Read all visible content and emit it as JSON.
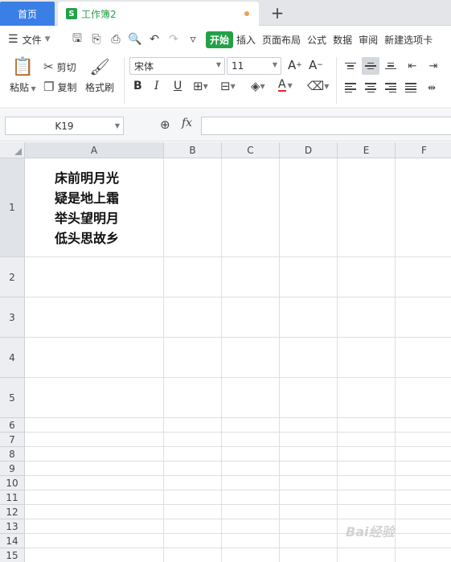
{
  "tabs": {
    "home_label": "首页",
    "doc_icon": "S",
    "doc_label": "工作簿2",
    "add_label": "+"
  },
  "menu": {
    "file_label": "文件",
    "ribbon_tabs": [
      "开始",
      "插入",
      "页面布局",
      "公式",
      "数据",
      "审阅",
      "新建选项卡"
    ]
  },
  "ribbon": {
    "paste_label": "粘贴",
    "cut_label": "剪切",
    "copy_label": "复制",
    "format_painter_label": "格式刷",
    "font_name": "宋体",
    "font_size": "11",
    "bold_label": "B",
    "italic_label": "I",
    "underline_label": "U",
    "grow_font_label": "A",
    "shrink_font_label": "A",
    "font_color_label": "A"
  },
  "formula_bar": {
    "name_box": "K19",
    "fx_label": "fx",
    "formula": ""
  },
  "sheet": {
    "columns": [
      "A",
      "B",
      "C",
      "D",
      "E",
      "F"
    ],
    "rows": [
      "1",
      "2",
      "3",
      "4",
      "5",
      "6",
      "7",
      "8",
      "9",
      "10",
      "11",
      "12",
      "13",
      "14",
      "15"
    ],
    "cell_A1_lines": [
      "床前明月光",
      "疑是地上霜",
      "举头望明月",
      "低头思故乡"
    ]
  },
  "watermark": "Bai经验"
}
